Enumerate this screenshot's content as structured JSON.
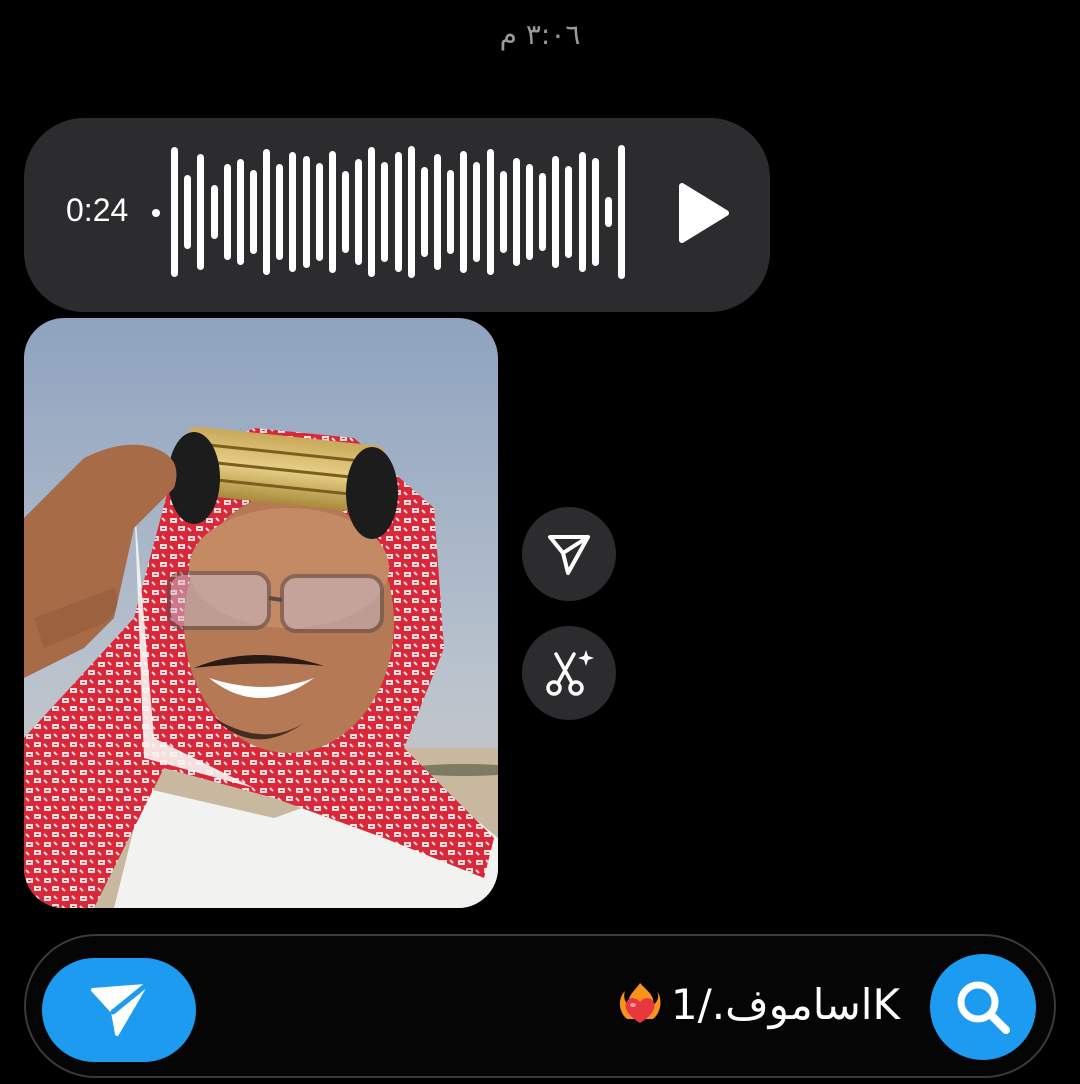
{
  "timestamp": "٣:٠٦ م",
  "voice_message": {
    "duration": "0:24",
    "waveform_levels": [
      0.95,
      0.55,
      0.85,
      0.4,
      0.7,
      0.78,
      0.62,
      0.92,
      0.7,
      0.88,
      0.82,
      0.72,
      0.9,
      0.6,
      0.78,
      0.95,
      0.74,
      0.88,
      0.97,
      0.66,
      0.86,
      0.62,
      0.9,
      0.74,
      0.92,
      0.6,
      0.8,
      0.7,
      0.58,
      0.82,
      0.68,
      0.88,
      0.8,
      0.22,
      0.98
    ],
    "play_icon": "play-icon"
  },
  "photo_message": {
    "alt": "selfie photo"
  },
  "actions": {
    "share_icon": "send-icon",
    "remix_icon": "scissors-sparkle-icon"
  },
  "composer": {
    "text": "اساموف./1K",
    "emoji": "heart-on-fire-icon",
    "send_icon": "send-icon",
    "search_icon": "search-icon"
  },
  "colors": {
    "accent": "#1d9bf0",
    "bubble": "#2c2c2e",
    "background": "#000000"
  }
}
